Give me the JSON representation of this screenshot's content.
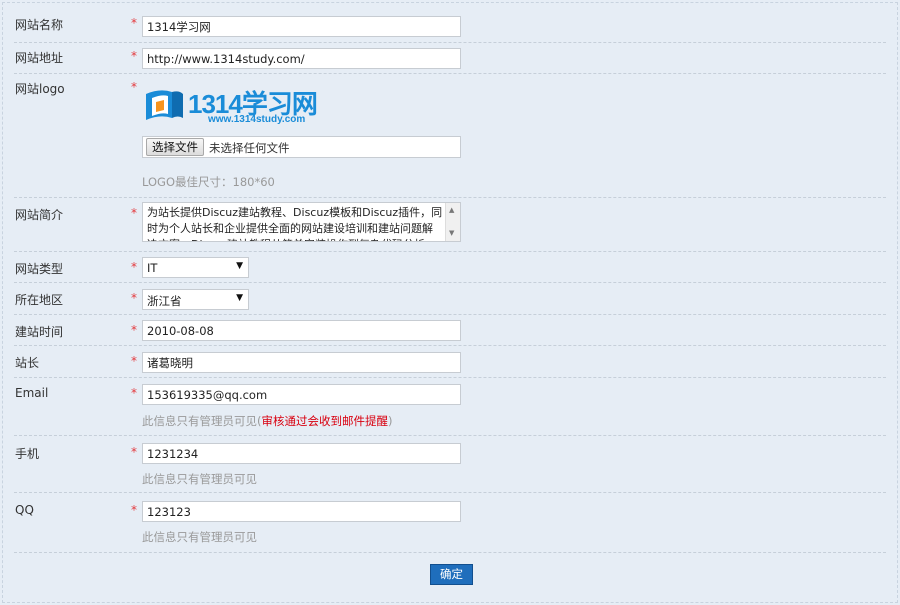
{
  "form": {
    "site_name": {
      "label": "网站名称",
      "required": "*",
      "value": "1314学习网"
    },
    "site_url": {
      "label": "网站地址",
      "required": "*",
      "value": "http://www.1314study.com/"
    },
    "site_logo": {
      "label": "网站logo",
      "required": "*",
      "logo_brand": "1314学习网",
      "logo_domain": "www.1314study.com",
      "file_button": "选择文件",
      "file_status": "未选择任何文件",
      "hint": "LOGO最佳尺寸：180*60"
    },
    "site_intro": {
      "label": "网站简介",
      "required": "*",
      "value": "为站长提供Discuz建站教程、Discuz模板和Discuz插件，同时为个人站长和企业提供全面的网站建设培训和建站问题解决方案。Discuz建站教程从简单安装操作到复杂代码分析"
    },
    "site_type": {
      "label": "网站类型",
      "required": "*",
      "value": "IT"
    },
    "region": {
      "label": "所在地区",
      "required": "*",
      "value": "浙江省"
    },
    "founded": {
      "label": "建站时间",
      "required": "*",
      "value": "2010-08-08"
    },
    "webmaster": {
      "label": "站长",
      "required": "*",
      "value": "诸葛晓明"
    },
    "email": {
      "label": "Email",
      "required": "*",
      "value": "153619335@qq.com",
      "hint": "此信息只有管理员可见(",
      "hint_red": "审核通过会收到邮件提醒",
      "hint_end": ")"
    },
    "phone": {
      "label": "手机",
      "required": "*",
      "value": "1231234",
      "hint": "此信息只有管理员可见"
    },
    "qq": {
      "label": "QQ",
      "required": "*",
      "value": "123123",
      "hint": "此信息只有管理员可见"
    },
    "submit_label": "确定"
  },
  "icons": {
    "dropdown": "▼",
    "scroll_up": "▲",
    "scroll_down": "▼"
  },
  "colors": {
    "background": "#e6edf5",
    "required": "#e4393c",
    "submit": "#1f6ebc",
    "logo": "#1a8cd8",
    "hint_red": "#d9000f"
  }
}
